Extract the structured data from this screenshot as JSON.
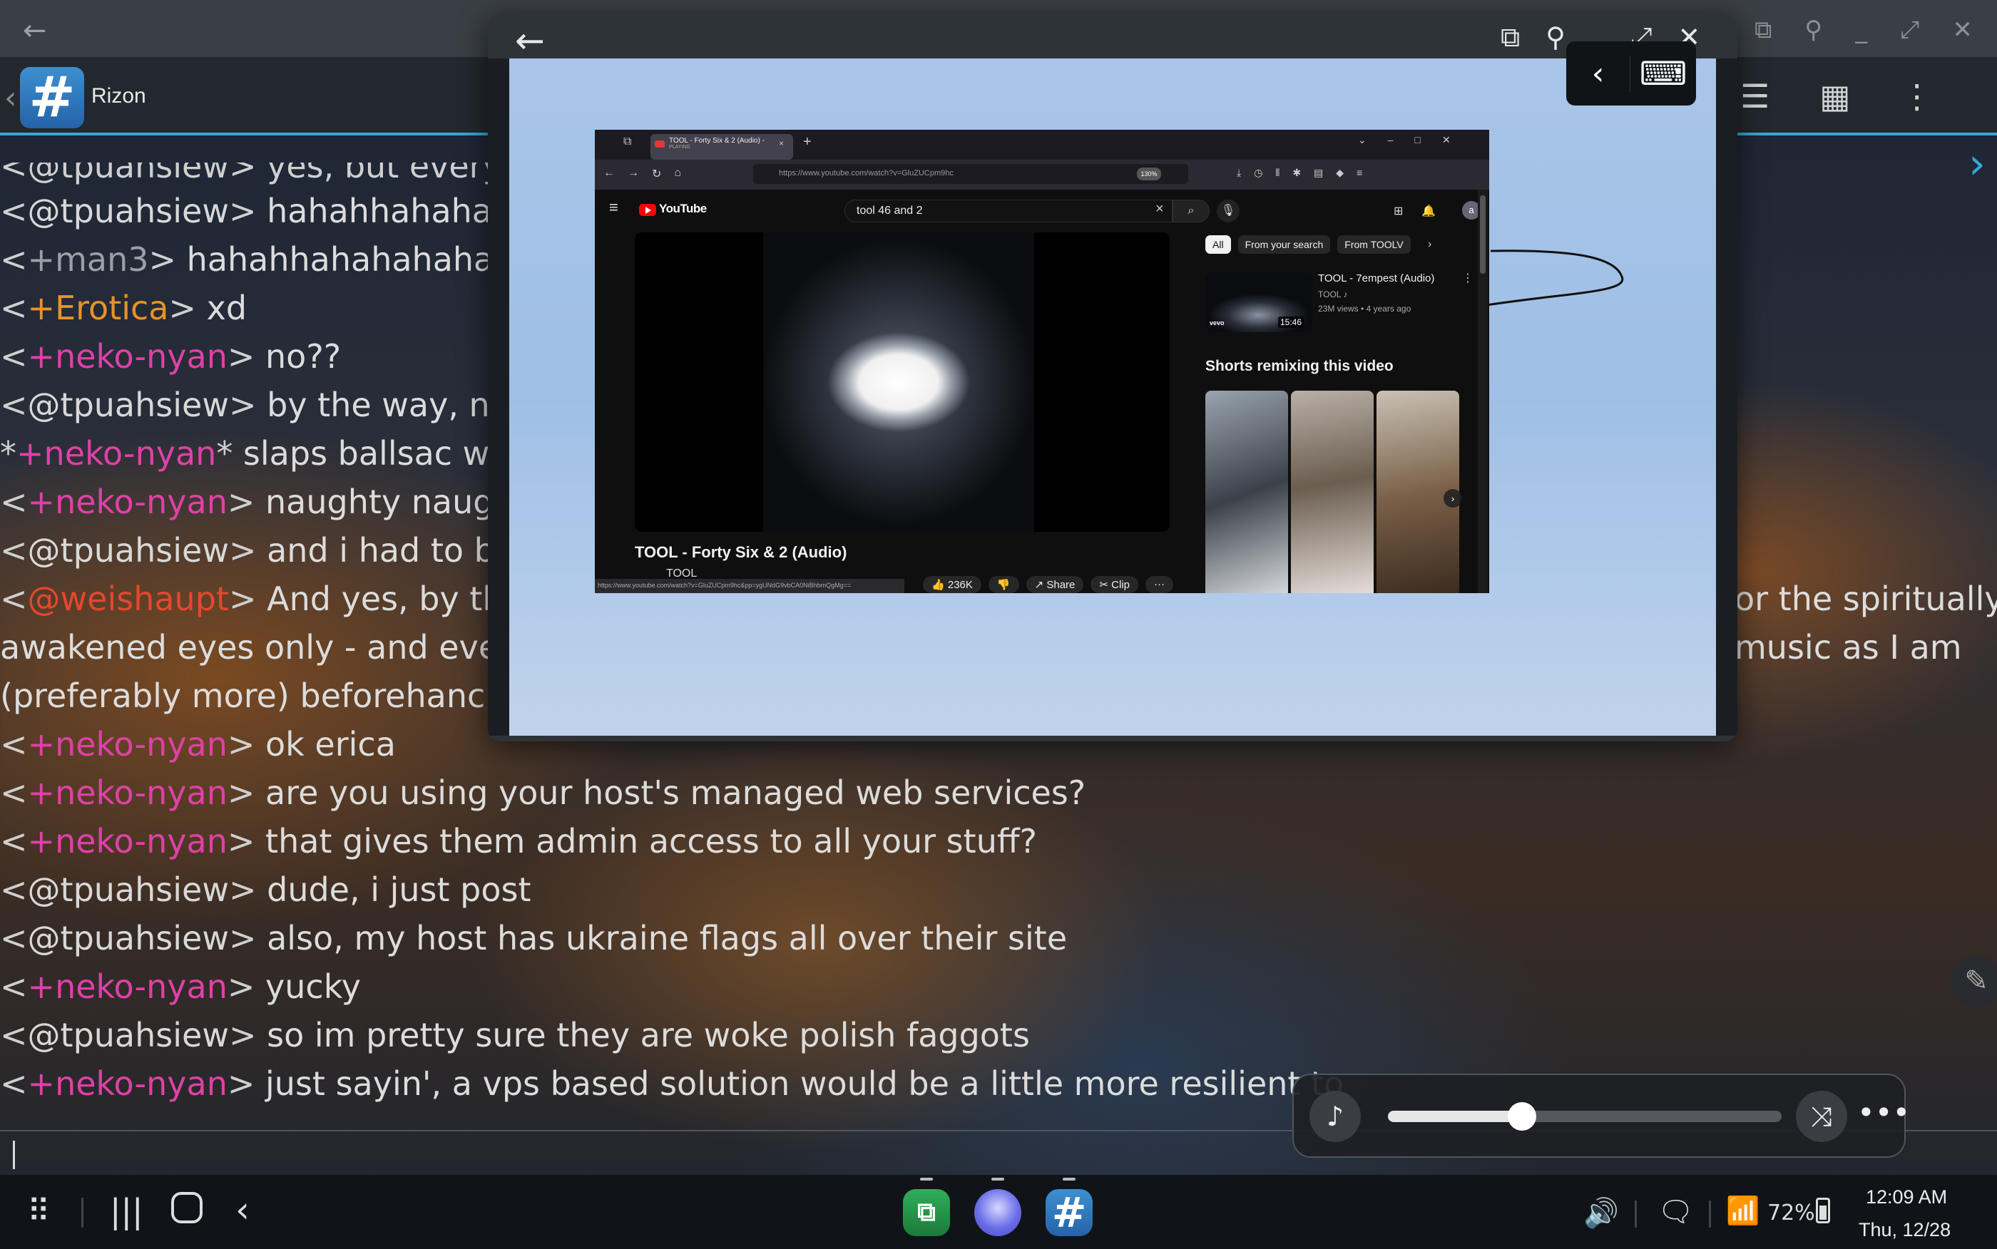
{
  "app": {
    "title": "Rizon",
    "icon": "hashtag-icon",
    "accent": "#3aa5d8"
  },
  "chat": {
    "partial_top_line": "<@tpuahsiew> yes, but every",
    "lines": [
      {
        "open": "<",
        "nick": "@tpuahsiew",
        "close": ">",
        "text": " hahahhahaha",
        "nick_color": "#d8d8d8"
      },
      {
        "open": "<",
        "nick": "+man3",
        "close": ">",
        "text": " hahahhahahahaha",
        "nick_color": "#9aa0a6"
      },
      {
        "open": "<",
        "nick": "+Erotica",
        "close": ">",
        "text": " xd",
        "nick_color": "#e6932a"
      },
      {
        "open": "<",
        "nick": "+neko-nyan",
        "close": ">",
        "text": " no??",
        "nick_color": "#e040a8"
      },
      {
        "open": "<",
        "nick": "@tpuahsiew",
        "close": ">",
        "text": " by the way, ne",
        "nick_color": "#d8d8d8"
      },
      {
        "open": "*",
        "nick": "+neko-nyan",
        "close": "*",
        "text": " slaps ballsac w",
        "nick_color": "#e040a8"
      },
      {
        "open": "<",
        "nick": "+neko-nyan",
        "close": ">",
        "text": " naughty naugl",
        "nick_color": "#e040a8"
      },
      {
        "open": "<",
        "nick": "@tpuahsiew",
        "close": ">",
        "text": " and i had to be",
        "nick_color": "#d8d8d8"
      },
      {
        "open": "<",
        "nick": "@weishaupt",
        "close": ">",
        "text": " And yes, by the",
        "nick_color": "#e5472f",
        "right_text": "or the spiritually"
      },
      {
        "open": "",
        "nick": "",
        "close": "",
        "text": "awakened eyes only - and eve",
        "nick_color": "#d8d8d8",
        "right_text": "music as I am"
      },
      {
        "open": "",
        "nick": "",
        "close": "",
        "text": "(preferably more) beforehanc",
        "nick_color": "#d8d8d8"
      },
      {
        "open": "<",
        "nick": "+neko-nyan",
        "close": ">",
        "text": " ok erica",
        "nick_color": "#e040a8"
      },
      {
        "open": "<",
        "nick": "+neko-nyan",
        "close": ">",
        "text": " are you using your host's managed web services?",
        "nick_color": "#e040a8"
      },
      {
        "open": "<",
        "nick": "+neko-nyan",
        "close": ">",
        "text": " that gives them admin access to all your stuff?",
        "nick_color": "#e040a8"
      },
      {
        "open": "<",
        "nick": "@tpuahsiew",
        "close": ">",
        "text": " dude, i just post",
        "nick_color": "#d8d8d8"
      },
      {
        "open": "<",
        "nick": "@tpuahsiew",
        "close": ">",
        "text": " also, my host has ukraine flags all over their site",
        "nick_color": "#d8d8d8"
      },
      {
        "open": "<",
        "nick": "+neko-nyan",
        "close": ">",
        "text": " yucky",
        "nick_color": "#e040a8"
      },
      {
        "open": "<",
        "nick": "@tpuahsiew",
        "close": ">",
        "text": " so im pretty sure they are woke polish faggots",
        "nick_color": "#d8d8d8"
      },
      {
        "open": "<",
        "nick": "+neko-nyan",
        "close": ">",
        "text": " just sayin', a vps based solution would be a little more resilient to",
        "nick_color": "#e040a8"
      }
    ]
  },
  "popup": {
    "back_icon": "arrow-left-icon",
    "controls": [
      "screenshot-icon",
      "pin-icon",
      "minimize-icon",
      "maximize-icon",
      "close-icon"
    ]
  },
  "browser": {
    "tab": {
      "title": "TOOL - Forty Six & 2 (Audio) -",
      "subtitle": "PLAYING",
      "close": "×"
    },
    "new_tab": "+",
    "url": "https://www.youtube.com/watch?v=GluZUCpm9hc",
    "zoom": "130%",
    "status_url": "https://www.youtube.com/watch?v=GluZUCpm9hc&pp=ygUNdG9vbCA0NiBhbmQgMg==",
    "youtube": {
      "logo": "YouTube",
      "search_value": "tool 46 and 2",
      "avatar": "a",
      "video_title": "TOOL - Forty Six & 2 (Audio)",
      "channel_partial": "TOOL",
      "likes": "236K",
      "share": "Share",
      "clip": "Clip",
      "more": "···",
      "chips": [
        {
          "label": "All",
          "selected": true
        },
        {
          "label": "From your search",
          "selected": false
        },
        {
          "label": "From TOOLV",
          "selected": false
        }
      ],
      "recommended": {
        "title": "TOOL - 7empest (Audio)",
        "channel": "TOOL ♪",
        "meta": "23M views • 4 years ago",
        "duration": "15:46",
        "badge": "vevo"
      },
      "shorts_heading": "Shorts remixing this video"
    }
  },
  "media": {
    "volume_fraction": 0.34,
    "note_icon": "music-note-icon",
    "shuffle_icon": "shuffle-icon",
    "more_label": "•••"
  },
  "taskbar": {
    "battery": "72%",
    "time": "12:09 AM",
    "date": "Thu, 12/28"
  }
}
